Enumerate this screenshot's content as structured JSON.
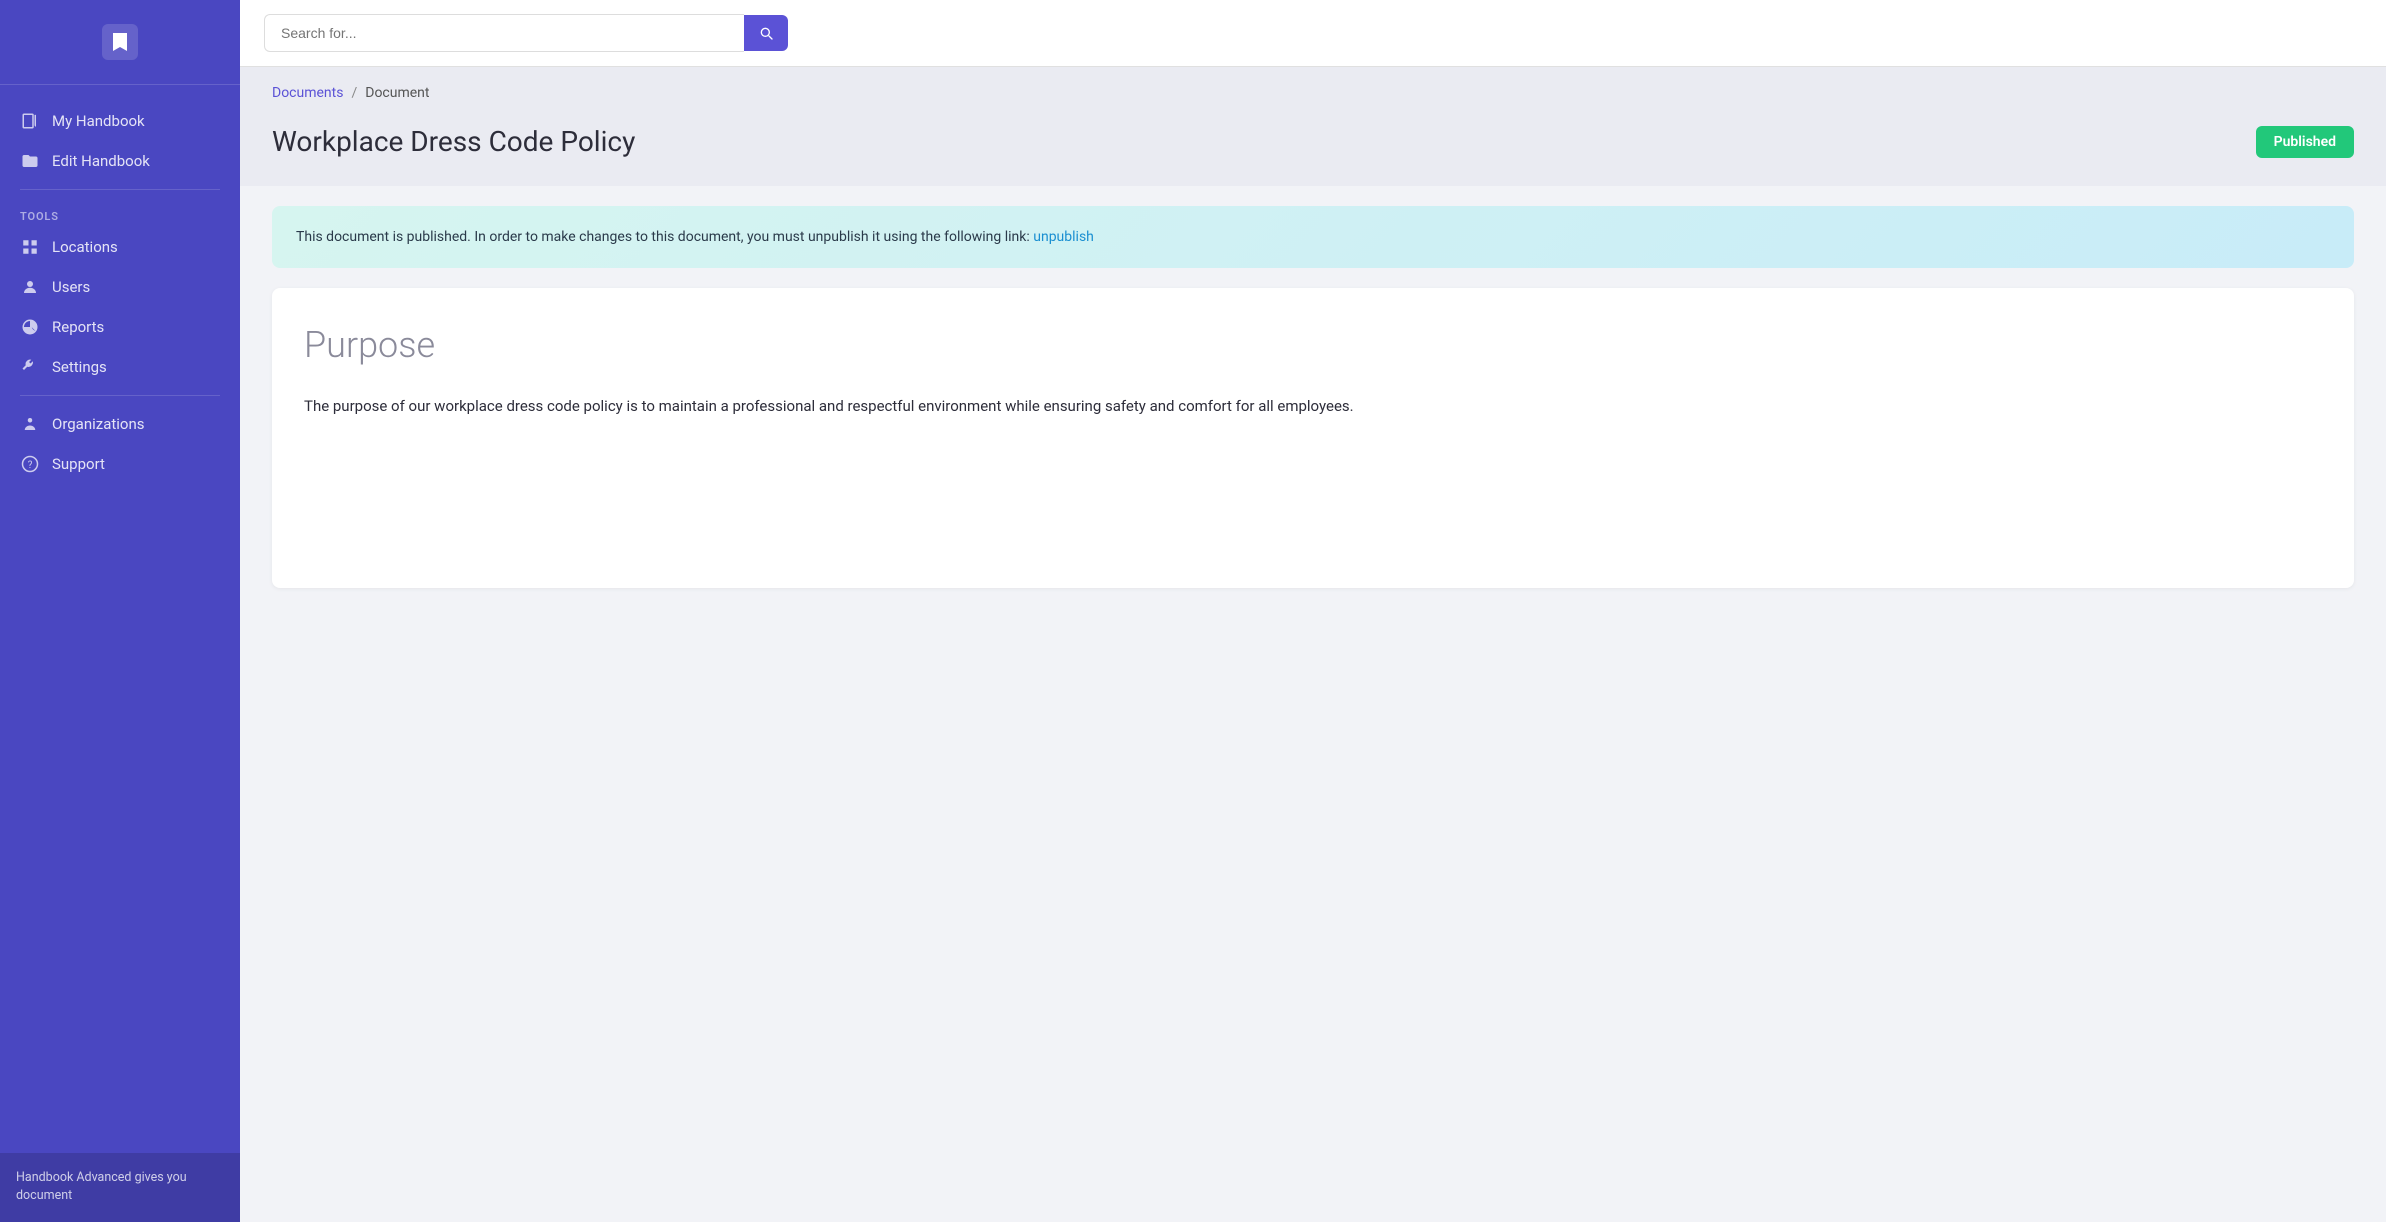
{
  "sidebar": {
    "logo_alt": "Handbook Logo",
    "nav_items": [
      {
        "id": "my-handbook",
        "label": "My Handbook",
        "icon": "book"
      },
      {
        "id": "edit-handbook",
        "label": "Edit Handbook",
        "icon": "folder"
      }
    ],
    "tools_label": "TOOLS",
    "tools_items": [
      {
        "id": "locations",
        "label": "Locations",
        "icon": "grid"
      },
      {
        "id": "users",
        "label": "Users",
        "icon": "person-circle"
      },
      {
        "id": "reports",
        "label": "Reports",
        "icon": "chart-pie"
      },
      {
        "id": "settings",
        "label": "Settings",
        "icon": "wrench"
      },
      {
        "id": "organizations",
        "label": "Organizations",
        "icon": "person"
      },
      {
        "id": "support",
        "label": "Support",
        "icon": "question-circle"
      }
    ],
    "footer_text": "Handbook Advanced gives you document"
  },
  "topbar": {
    "search_placeholder": "Search for...",
    "search_button_label": "Search"
  },
  "breadcrumb": {
    "link_label": "Documents",
    "separator": "/",
    "current": "Document"
  },
  "document": {
    "title": "Workplace Dress Code Policy",
    "status_badge": "Published",
    "alert_text": "This document is published. In order to make changes to this document, you must unpublish it using the following link: ",
    "alert_link_text": "unpublish",
    "section_heading": "Purpose",
    "section_body": "The purpose of our workplace dress code policy is to maintain a professional and respectful environment while ensuring safety and comfort for all employees."
  }
}
